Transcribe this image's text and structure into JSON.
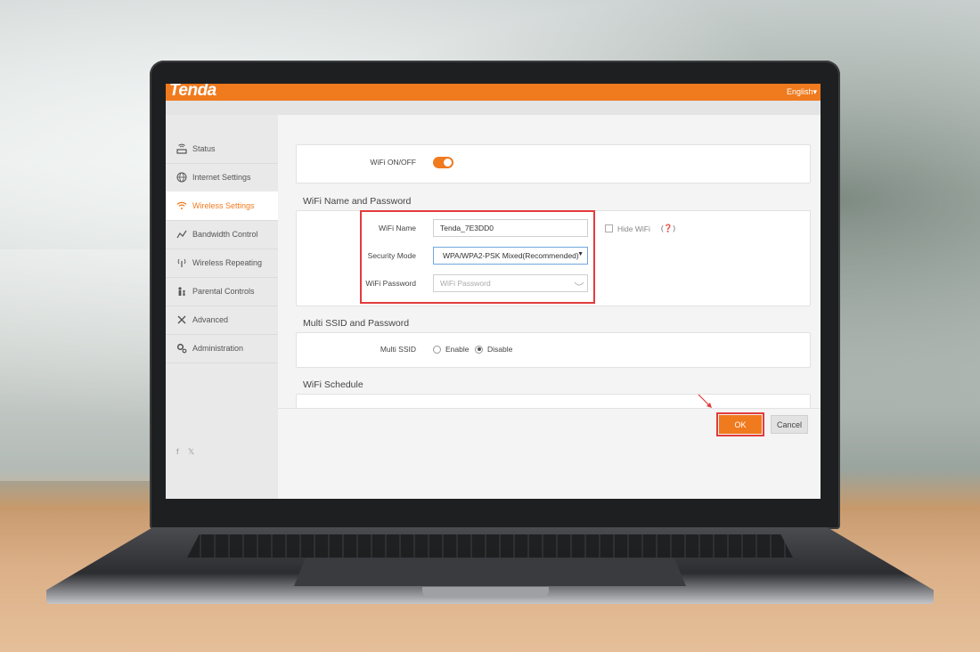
{
  "app": {
    "brand": "Tenda",
    "language": "English▾"
  },
  "sidebar": {
    "items": [
      {
        "label": "Status",
        "icon": "router-icon"
      },
      {
        "label": "Internet Settings",
        "icon": "globe-icon"
      },
      {
        "label": "Wireless Settings",
        "icon": "wifi-icon",
        "active": true
      },
      {
        "label": "Bandwidth Control",
        "icon": "bandwidth-icon"
      },
      {
        "label": "Wireless Repeating",
        "icon": "antenna-icon"
      },
      {
        "label": "Parental Controls",
        "icon": "parental-icon"
      },
      {
        "label": "Advanced",
        "icon": "tools-icon"
      },
      {
        "label": "Administration",
        "icon": "gears-icon"
      }
    ],
    "social": "f 𝕏"
  },
  "wifi_toggle": {
    "label": "WiFi ON/OFF",
    "state": "on"
  },
  "wifi_name_password": {
    "title": "WiFi Name and Password",
    "name_label": "WiFi Name",
    "name_value": "Tenda_7E3DD0",
    "hide_wifi_label": "Hide WiFi",
    "help": "(❓)",
    "security_label": "Security Mode",
    "security_value": "WPA/WPA2-PSK Mixed(Recommended)",
    "password_label": "WiFi Password",
    "password_placeholder": "WiFi Password"
  },
  "multi_ssid": {
    "title": "Multi SSID and Password",
    "label": "Multi SSID",
    "enable_label": "Enable",
    "disable_label": "Disable",
    "selected": "Disable"
  },
  "wifi_schedule": {
    "title": "WiFi Schedule"
  },
  "actions": {
    "ok_label": "OK",
    "cancel_label": "Cancel"
  },
  "colors": {
    "accent": "#f07a1e",
    "highlight": "#e33b3b"
  }
}
